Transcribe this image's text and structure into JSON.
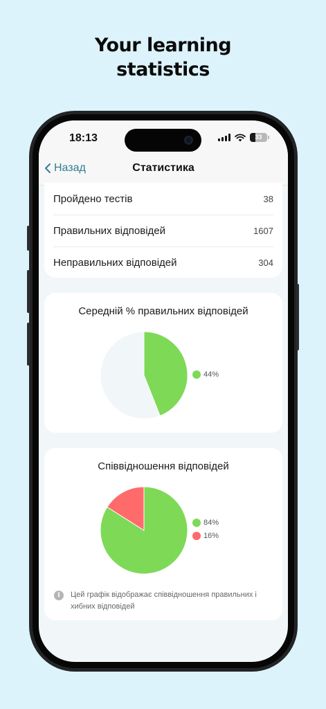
{
  "headline": {
    "line1": "Your learning",
    "line2": "statistics"
  },
  "status_bar": {
    "time": "18:13",
    "battery": "33",
    "battery_level": 0.33
  },
  "nav": {
    "back_label": "Назад",
    "title": "Статистика"
  },
  "stats": [
    {
      "label": "Пройдено тестів",
      "value": "38"
    },
    {
      "label": "Правильних відповідей",
      "value": "1607"
    },
    {
      "label": "Неправильних відповідей",
      "value": "304"
    }
  ],
  "avg_card": {
    "title": "Середній % правильних відповідей"
  },
  "ratio_card": {
    "title": "Співвідношення відповідей",
    "info_text": "Цей графік відображає співвідношення правильних і хибних відповідей"
  },
  "colors": {
    "correct": "#7ed957",
    "incorrect": "#ff6b6b",
    "remainder": "#f1f6f9",
    "accent": "#2e7d92"
  },
  "icons": {
    "back": "chevron-left-icon",
    "info": "info-icon",
    "wifi": "wifi-icon",
    "signal": "cellular-signal-icon",
    "battery": "battery-icon"
  },
  "chart_data": [
    {
      "type": "pie",
      "title": "Середній % правильних відповідей",
      "series": [
        {
          "values": [
            44,
            56
          ]
        }
      ],
      "legend": [
        "44%"
      ],
      "legend_placement": "right"
    },
    {
      "type": "pie",
      "title": "Співвідношення відповідей",
      "series": [
        {
          "values": [
            84,
            16
          ]
        }
      ],
      "legend": [
        "84%",
        "16%"
      ],
      "legend_placement": "right"
    }
  ]
}
